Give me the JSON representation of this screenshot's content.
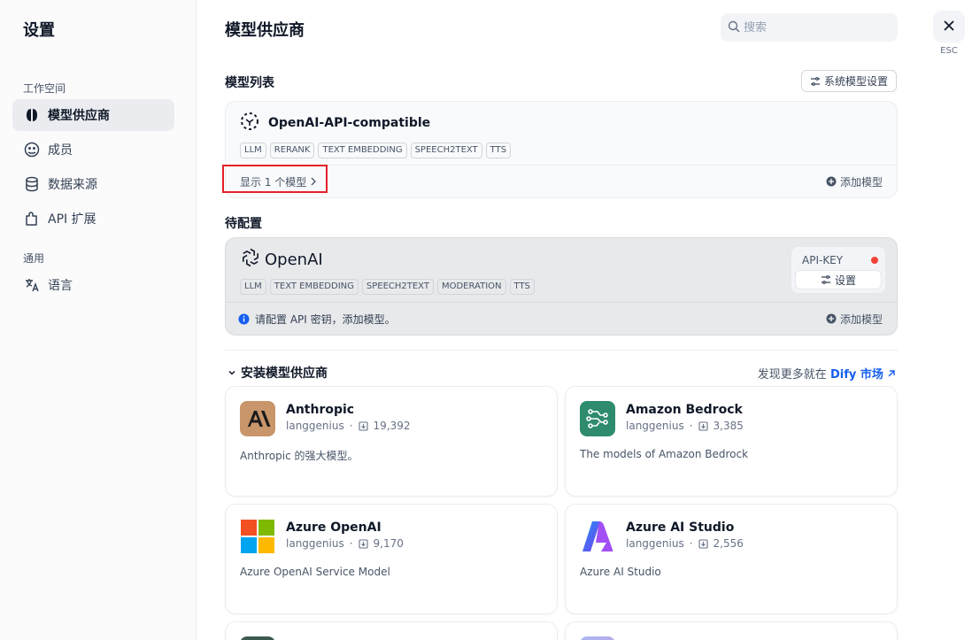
{
  "sidebar": {
    "title": "设置",
    "group_workspace": "工作空间",
    "group_general": "通用",
    "items": [
      {
        "label": "模型供应商"
      },
      {
        "label": "成员"
      },
      {
        "label": "数据来源"
      },
      {
        "label": "API 扩展"
      },
      {
        "label": "语言"
      }
    ]
  },
  "header": {
    "title": "模型供应商",
    "search_placeholder": "搜索",
    "esc_label": "ESC"
  },
  "model_list": {
    "label": "模型列表",
    "system_settings_label": "系统模型设置",
    "provider": {
      "name": "OpenAI-API-compatible",
      "tags": [
        "LLM",
        "RERANK",
        "TEXT EMBEDDING",
        "SPEECH2TEXT",
        "TTS"
      ],
      "show_models_label": "显示 1 个模型",
      "add_model_label": "添加模型"
    }
  },
  "pending": {
    "label": "待配置",
    "provider": {
      "name": "OpenAI",
      "tags": [
        "LLM",
        "TEXT EMBEDDING",
        "SPEECH2TEXT",
        "MODERATION",
        "TTS"
      ],
      "api_key_label": "API-KEY",
      "settings_label": "设置",
      "info_text": "请配置 API 密钥，添加模型。",
      "add_model_label": "添加模型"
    }
  },
  "install": {
    "label": "安装模型供应商",
    "market_prefix": "发现更多就在",
    "market_link": "Dify 市场",
    "providers": [
      {
        "name": "Anthropic",
        "author": "langgenius",
        "installs": "19,392",
        "desc": "Anthropic 的强大模型。",
        "icon": "anthropic-logo",
        "color": "#c9956b"
      },
      {
        "name": "Amazon Bedrock",
        "author": "langgenius",
        "installs": "3,385",
        "desc": "The models of Amazon Bedrock",
        "icon": "bedrock-logo",
        "color": "#2e8b6e"
      },
      {
        "name": "Azure OpenAI",
        "author": "langgenius",
        "installs": "9,170",
        "desc": "Azure OpenAI Service Model",
        "icon": "microsoft-logo",
        "color": "#f25022"
      },
      {
        "name": "Azure AI Studio",
        "author": "langgenius",
        "installs": "2,556",
        "desc": "Azure AI Studio",
        "icon": "azure-logo",
        "color": "#0078d4"
      }
    ]
  }
}
